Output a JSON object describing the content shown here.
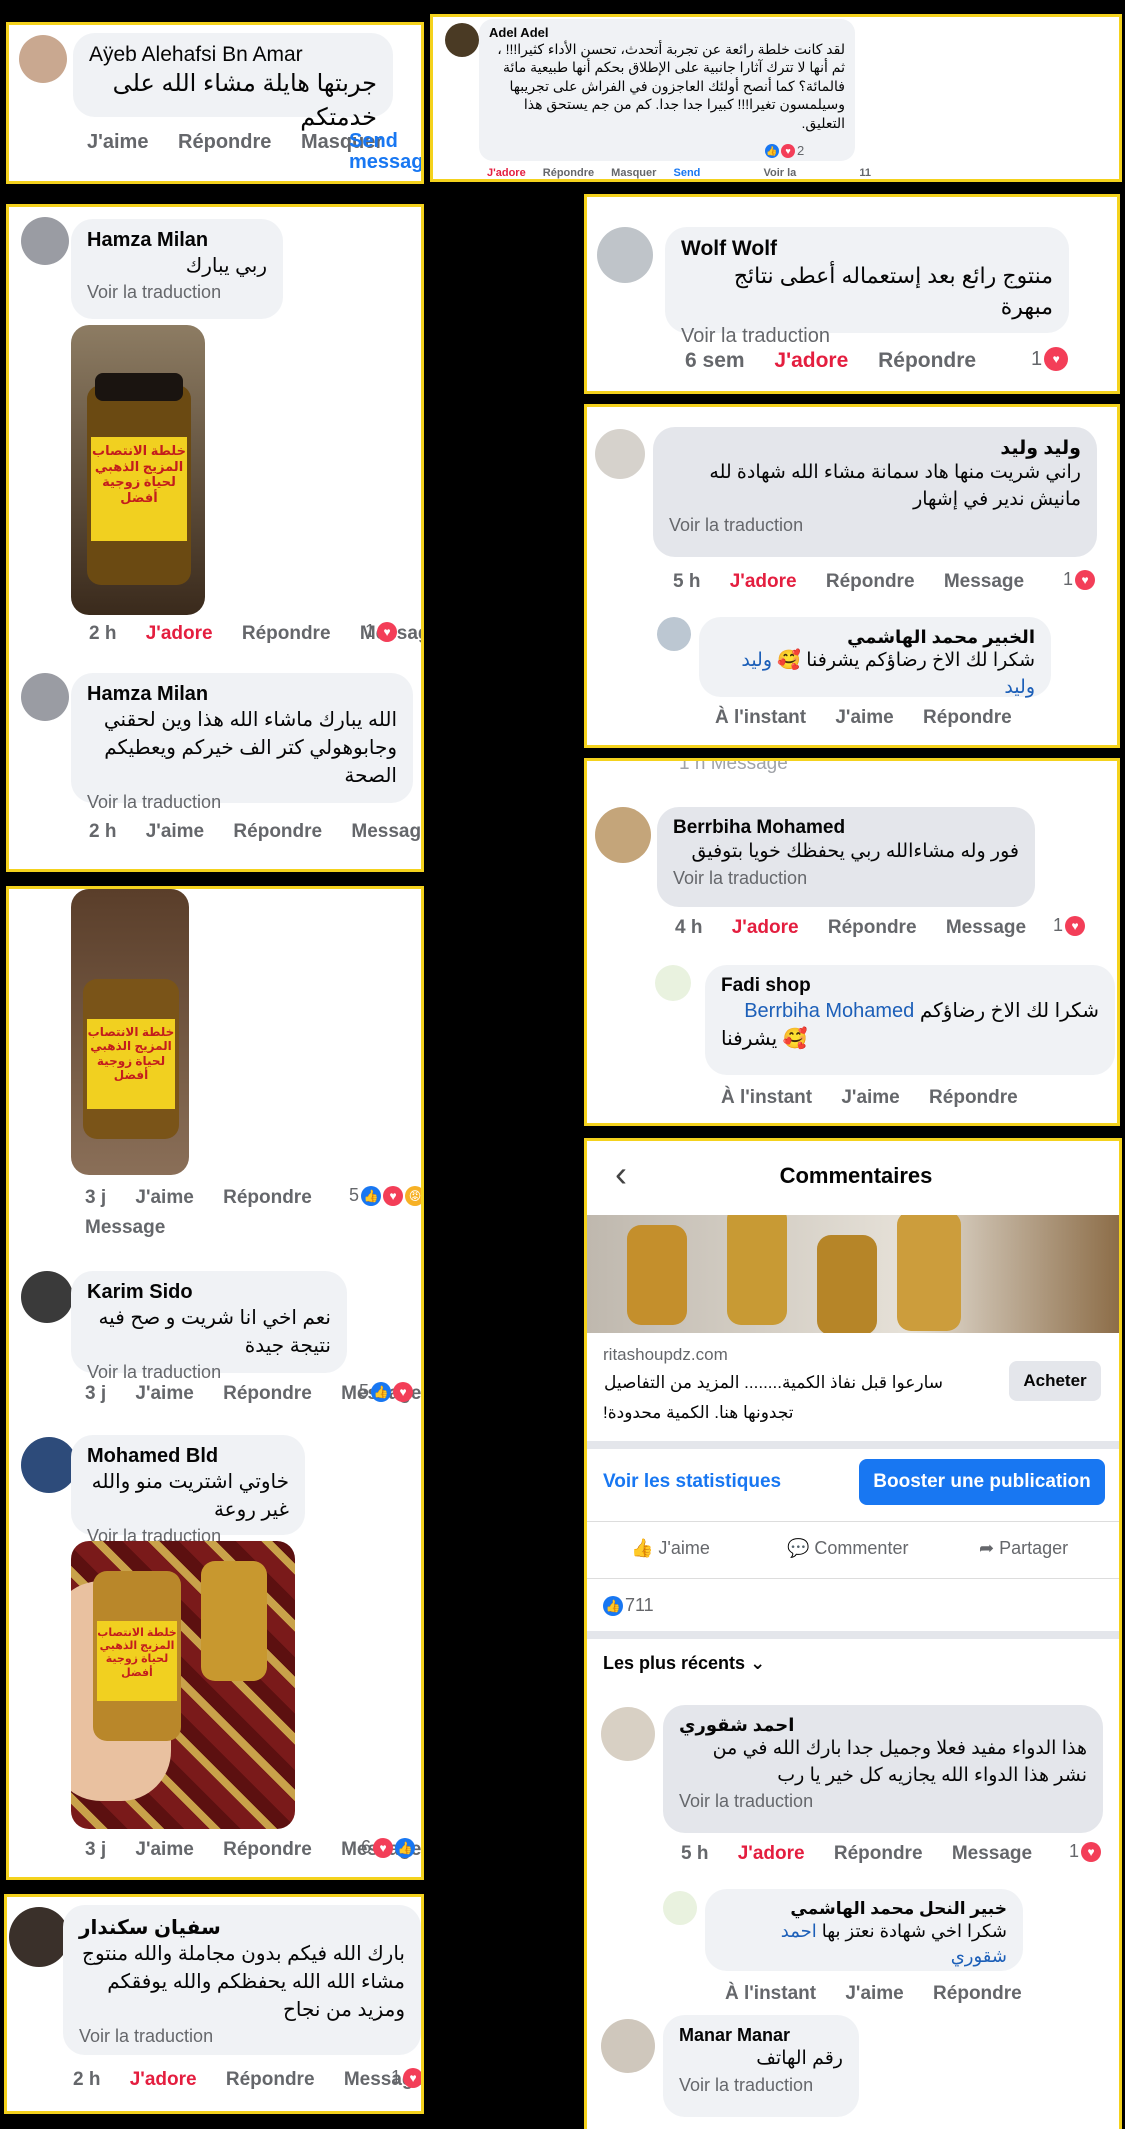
{
  "c1": {
    "name": "Aÿeb Alehafsi Bn Amar",
    "text": "جربتها هايلة مشاء الله على خدمتكم",
    "like": "J'aime",
    "reply": "Répondre",
    "hide": "Masquer",
    "send": "Send message"
  },
  "c2": {
    "name": "Adel Adel",
    "text": "لقد كانت خلطة رائعة عن تجربة أتحدث، تحسن الأداء كثيرا!!! ، ثم أنها لا تترك آثارا جانبية على الإطلاق بحكم أنها طبيعية مائة فالمائة؟ كما أنصح أولئك العاجزون في الفراش على تجريبها وسيلمسون تغيرا!!! كبيرا جدا جدا. كم من جم يستحق هذا التعليق.",
    "count": "2",
    "like": "J'adore",
    "reply": "Répondre",
    "hide": "Masquer",
    "send": "Send",
    "see": "Voir la",
    "num": "11"
  },
  "c3": {
    "name": "Hamza Milan",
    "text": "ربي يبارك",
    "trans": "Voir la traduction",
    "time": "2 h",
    "like": "J'adore",
    "reply": "Répondre",
    "msg": "Message",
    "count": "1",
    "jar_text": "خلطة الانتصاب المزيج الذهبي لحياة زوجية أفضل"
  },
  "c4": {
    "name": "Hamza Milan",
    "text": "الله يبارك ماشاء الله هذا وين لحقني وجابوهولي كتر الف خيركم ويعطيكم الصحة",
    "trans": "Voir la traduction",
    "time": "2 h",
    "like": "J'aime",
    "reply": "Répondre",
    "msg": "Message"
  },
  "c5": {
    "name": "Wolf Wolf",
    "text": "منتوج رائع بعد إستعماله أعطى نتائج مبهرة",
    "trans": "Voir la traduction",
    "time": "6 sem",
    "like": "J'adore",
    "reply": "Répondre",
    "count": "1"
  },
  "c6": {
    "name": "وليد وليد",
    "text": "راني شريت منها هاد سمانة مشاء الله شهادة لله مانيش ندير في إشهار",
    "trans": "Voir la traduction",
    "time": "5 h",
    "like": "J'adore",
    "reply": "Répondre",
    "msg": "Message",
    "count": "1",
    "reply_name": "الخبير محمد الهاشمي",
    "reply_mention": "وليد وليد",
    "reply_text": "شكرا لك الاخ رضاؤكم يشرفنا 🥰",
    "reply_time": "À l'instant",
    "reply_like": "J'aime",
    "reply_reply": "Répondre"
  },
  "c7": {
    "top_cut": "1 h   Message",
    "name": "Berrbiha Mohamed",
    "text": "فور وله مشاءالله ربي يحفظك خويا بتوفيق",
    "trans": "Voir la traduction",
    "time": "4 h",
    "like": "J'adore",
    "reply": "Répondre",
    "msg": "Message",
    "count": "1",
    "reply_name": "Fadi shop",
    "reply_mention": "Berrbiha Mohamed",
    "reply_text": "شكرا لك الاخ رضاؤكم",
    "reply_text2": "يشرفنا 🥰",
    "reply_time": "À l'instant",
    "reply_like": "J'aime",
    "reply_reply": "Répondre"
  },
  "c8": {
    "time": "3 j",
    "like": "J'aime",
    "reply": "Répondre",
    "msg": "Message",
    "count": "5"
  },
  "c9": {
    "name": "Karim Sido",
    "text": "نعم اخي انا شريت و صح فيه نتيجة جيدة",
    "trans": "Voir la traduction",
    "time": "3 j",
    "like": "J'aime",
    "reply": "Répondre",
    "msg": "Message",
    "count": "5"
  },
  "c10": {
    "name": "Mohamed Bld",
    "text": "خاوتي اشتريت منو والله غير روعة",
    "trans": "Voir la traduction",
    "time": "3 j",
    "like": "J'aime",
    "reply": "Répondre",
    "msg": "Message",
    "count": "6"
  },
  "c11": {
    "name": "سفيان سكندار",
    "text": "بارك الله فيكم بدون مجاملة والله منتوج مشاء الله الله يحفظكم والله يوفقكم ومزيد من نجاح",
    "trans": "Voir la traduction",
    "time": "2 h",
    "like": "J'adore",
    "reply": "Répondre",
    "msg": "Message",
    "count": "1"
  },
  "fb": {
    "title": "Commentaires",
    "back": "‹",
    "domain": "ritashoupdz.com",
    "ad_text": "سارعوا قبل نفاذ الكمية........ المزيد من التفاصيل",
    "ad_text2": "تجدونها هنا. الكمية محدودة!",
    "buy": "Acheter",
    "stats": "Voir les statistiques",
    "boost": "Booster une publication",
    "like": "J'aime",
    "comment": "Commenter",
    "share": "Partager",
    "likes_count": "711",
    "sort": "Les plus récents",
    "c1_name": "احمد شقوري",
    "c1_text": "هذا الدواء مفيد فعلا وجميل جدا بارك الله في من نشر هذا الدواء الله يجازيه كل خير يا رب",
    "c1_trans": "Voir la traduction",
    "c1_time": "5 h",
    "c1_like": "J'adore",
    "c1_reply": "Répondre",
    "c1_msg": "Message",
    "c1_count": "1",
    "r_name": "خبير النحل محمد الهاشمي",
    "r_mention": "احمد شقوري",
    "r_text": "شكرا اخي شهادة نعتز بها",
    "r_time": "À l'instant",
    "r_like": "J'aime",
    "r_reply": "Répondre",
    "c2_name": "Manar Manar",
    "c2_text": "رقم الهاتف",
    "c2_trans": "Voir la traduction"
  }
}
